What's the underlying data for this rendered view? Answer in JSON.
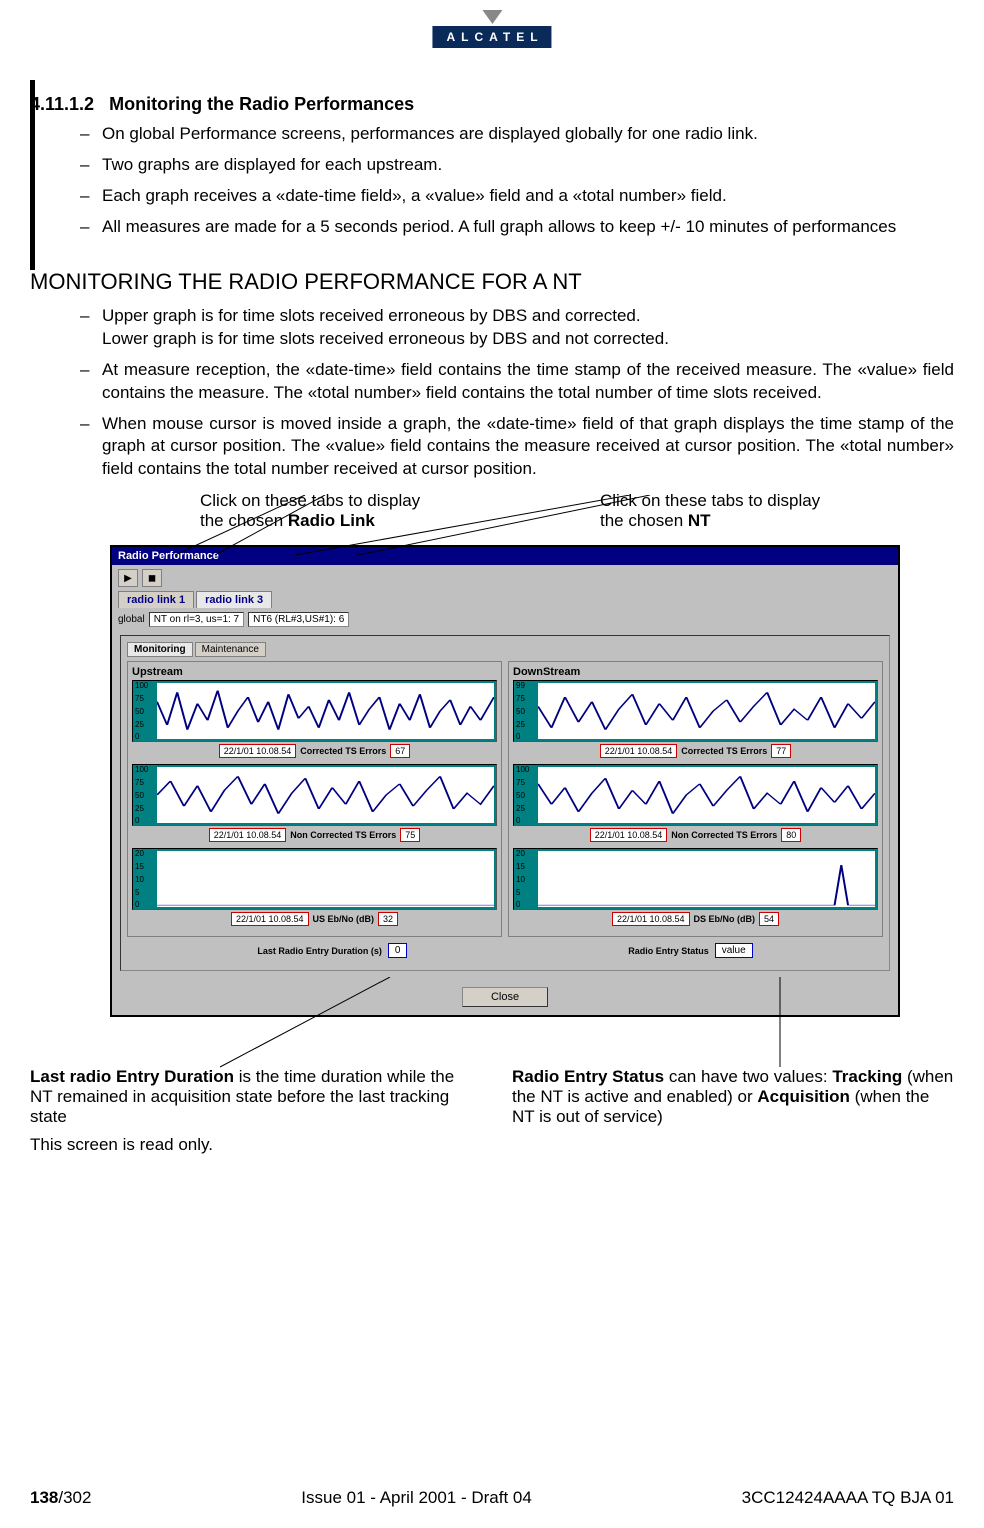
{
  "logo": "ALCATEL",
  "section_no": "4.11.1.2",
  "section_title": "Monitoring the Radio Performances",
  "bullets_a": [
    "On global Performance screens, performances are displayed globally for one radio link.",
    "Two graphs are displayed for each upstream.",
    "Each graph receives a «date-time field», a «value» field and a «total number» field.",
    "All measures are made for a 5 seconds period. A full graph allows to keep +/- 10 minutes of performances"
  ],
  "h2": "MONITORING THE RADIO PERFORMANCE FOR A NT",
  "bullets_b": [
    "Upper graph is for time slots received erroneous by DBS and corrected.\nLower graph  is for time slots received erroneous by DBS and not corrected.",
    "At measure reception, the «date-time» field contains the time stamp of the received measure. The «value» field contains the measure. The «total number» field contains the total number of time slots received.",
    "When mouse cursor is moved inside a graph, the «date-time» field of that graph displays the time stamp of the graph at cursor position. The «value» field contains the measure received at cursor position. The «total number» field contains the total number received at cursor position."
  ],
  "callout_left_1": "Click on these tabs to display",
  "callout_left_2_pre": "the chosen ",
  "callout_left_2_b": "Radio Link",
  "callout_right_1": "Click on these tabs to display",
  "callout_right_2_pre": "the chosen ",
  "callout_right_2_b": "NT",
  "window": {
    "title": "Radio Performance",
    "tabs": [
      "radio link 1",
      "radio link 3"
    ],
    "sub_global": "global",
    "sub_nt1": "NT on rl=3, us=1: 7",
    "sub_nt2": "NT6 (RL#3,US#1): 6",
    "inner_tabs": [
      "Monitoring",
      "Maintenance"
    ],
    "upstream_label": "Upstream",
    "downstream_label": "DownStream",
    "charts": {
      "up": [
        {
          "ticks": [
            "100",
            "75",
            "50",
            "25",
            "0"
          ],
          "date": "22/1/01 10.08.54",
          "label": "Corrected TS Errors",
          "value": "67"
        },
        {
          "ticks": [
            "100",
            "75",
            "50",
            "25",
            "0"
          ],
          "date": "22/1/01 10.08.54",
          "label": "Non Corrected TS Errors",
          "value": "75"
        },
        {
          "ticks": [
            "20",
            "15",
            "10",
            "5",
            "0"
          ],
          "date": "22/1/01 10.08.54",
          "label": "US Eb/No (dB)",
          "value": "32"
        }
      ],
      "down": [
        {
          "ticks": [
            "99",
            "75",
            "50",
            "25",
            "0"
          ],
          "date": "22/1/01 10.08.54",
          "label": "Corrected TS Errors",
          "value": "77"
        },
        {
          "ticks": [
            "100",
            "75",
            "50",
            "25",
            "0"
          ],
          "date": "22/1/01 10.08.54",
          "label": "Non Corrected TS Errors",
          "value": "80"
        },
        {
          "ticks": [
            "20",
            "15",
            "10",
            "5",
            "0"
          ],
          "date": "22/1/01 10.08.54",
          "label": "DS Eb/No (dB)",
          "value": "54"
        }
      ]
    },
    "last_entry_label": "Last Radio Entry Duration (s)",
    "last_entry_value": "0",
    "status_label": "Radio Entry Status",
    "status_value": "value",
    "close": "Close"
  },
  "bc_left_b": "Last radio Entry Duration",
  "bc_left_rest": " is the time duration while the NT remained in acquisition state before the last tracking state",
  "bc_right_b1": "Radio Entry Status",
  "bc_right_mid1": " can have two values: ",
  "bc_right_b2": "Tracking",
  "bc_right_mid2": "  (when the NT is active and enabled) or ",
  "bc_right_b3": "Acquisition",
  "bc_right_end": " (when the NT is out of service)",
  "readonly": "This screen is read only.",
  "footer": {
    "page_b": "138",
    "page_rest": "/302",
    "center": "Issue 01 - April 2001 - Draft 04",
    "right": "3CC12424AAAA TQ BJA 01"
  },
  "chart_data": [
    {
      "type": "line",
      "title": "Upstream Corrected TS Errors",
      "ylabel": "",
      "ylim": [
        0,
        100
      ],
      "x": "time (approx 120 samples / ~10 min)",
      "values_note": "random-walk signal, sample value at cursor = 67"
    },
    {
      "type": "line",
      "title": "Upstream Non Corrected TS Errors",
      "ylabel": "",
      "ylim": [
        0,
        100
      ],
      "values_note": "random-walk signal, sample value at cursor = 75"
    },
    {
      "type": "line",
      "title": "US Eb/No (dB)",
      "ylabel": "dB",
      "ylim": [
        0,
        20
      ],
      "values_note": "mostly flat near 0, value box = 32"
    },
    {
      "type": "line",
      "title": "DownStream Corrected TS Errors",
      "ylabel": "",
      "ylim": [
        0,
        99
      ],
      "values_note": "random-walk signal, sample value at cursor = 77"
    },
    {
      "type": "line",
      "title": "DownStream Non Corrected TS Errors",
      "ylabel": "",
      "ylim": [
        0,
        100
      ],
      "values_note": "random-walk signal, sample value at cursor = 80"
    },
    {
      "type": "line",
      "title": "DS Eb/No (dB)",
      "ylabel": "dB",
      "ylim": [
        0,
        20
      ],
      "values_note": "mostly flat near 0 with spike near end, value box = 54"
    }
  ]
}
